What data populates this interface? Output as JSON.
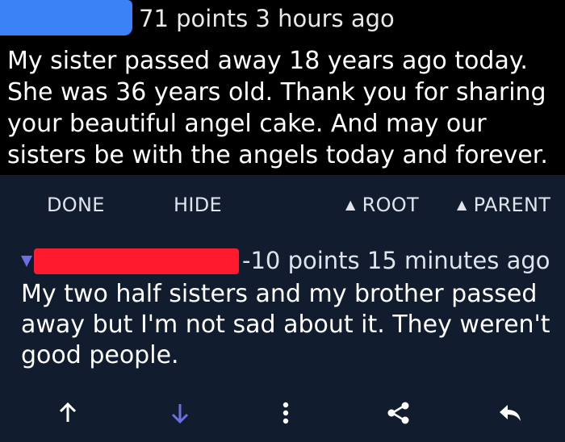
{
  "top_comment": {
    "meta": "71 points 3 hours ago",
    "body": "My sister passed away 18 years ago today. She was 36 years old. Thank you for sharing your beautiful angel cake. And may our sisters be with the angels today and forever."
  },
  "actions": {
    "done": "DONE",
    "hide": "HIDE",
    "root": "ROOT",
    "parent": "PARENT"
  },
  "reply_comment": {
    "meta": "-10 points 15 minutes ago",
    "body": "My two half sisters and my brother passed away but I'm not sad about it. They weren't good people."
  },
  "toolbar_icons": [
    "upvote-icon",
    "downvote-icon",
    "more-options-icon",
    "share-icon",
    "reply-icon"
  ],
  "colors": {
    "top_background": "#000000",
    "reply_background": "#111c2e",
    "downvote_accent": "#6b6fe6",
    "redaction_blue": "#3b82f6",
    "redaction_red": "#ff1a2e"
  }
}
